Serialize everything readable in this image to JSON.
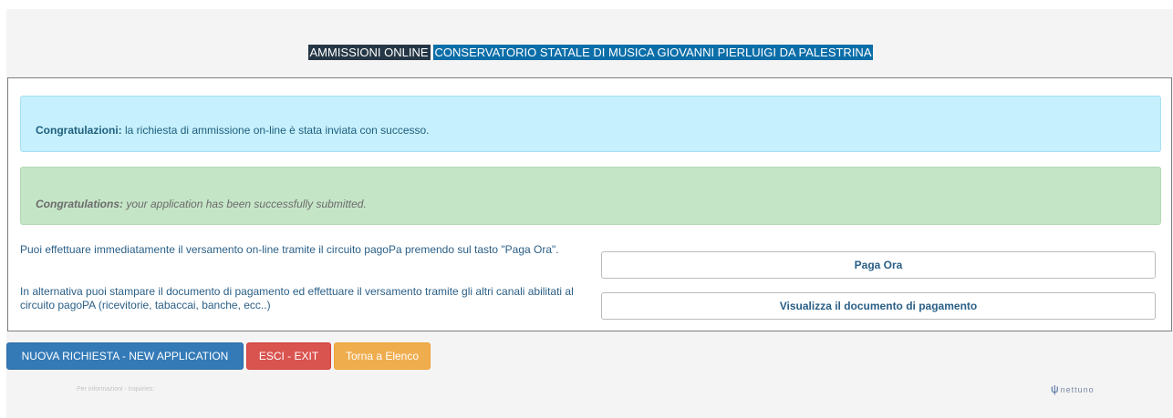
{
  "header": {
    "label_dark": "AMMISSIONI ONLINE",
    "label_blue": "CONSERVATORIO STATALE DI MUSICA GIOVANNI PIERLUIGI DA PALESTRINA"
  },
  "alerts": {
    "info_strong": "Congratulazioni:",
    "info_text": " la richiesta di ammissione on-line è stata inviata con successo.",
    "success_strong": "Congratulations:",
    "success_text": " your application has been successfully submitted."
  },
  "payment": {
    "online_text": "Puoi effettuare immediatamente il versamento on-line tramite il circuito pagoPa premendo sul tasto \"Paga Ora\".",
    "online_button": "Paga Ora",
    "print_text": "In alternativa puoi stampare il documento di pagamento ed effettuare il versamento tramite gli altri canali abilitati al circuito pagoPA (ricevitorie, tabaccai, banche, ecc..)",
    "print_button": "Visualizza il documento di pagamento"
  },
  "actions": {
    "new_application": "NUOVA RICHIESTA - NEW APPLICATION",
    "exit": "ESCI - EXIT",
    "back_to_list": "Torna a Elenco"
  },
  "footer": {
    "info": "Per informazioni - Inquiries:",
    "logo": "nettuno"
  },
  "colors": {
    "primary": "#337ab7",
    "danger": "#d9534f",
    "warning": "#f0ad4e",
    "info_bg": "#c6f0fd",
    "success_bg": "#c5e5c7"
  }
}
